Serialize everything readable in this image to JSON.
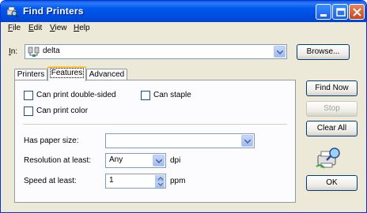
{
  "window": {
    "title": "Find Printers"
  },
  "menu": [
    {
      "label": "File",
      "key": "F",
      "rest": "ile"
    },
    {
      "label": "Edit",
      "key": "E",
      "rest": "dit"
    },
    {
      "label": "View",
      "key": "V",
      "rest": "iew"
    },
    {
      "label": "Help",
      "key": "H",
      "rest": "elp"
    }
  ],
  "location": {
    "label_key": "I",
    "label_rest": "n:",
    "value": "delta"
  },
  "tabs": [
    {
      "label": "Printers",
      "active": false
    },
    {
      "label": "Features",
      "active": true
    },
    {
      "label": "Advanced",
      "active": false
    }
  ],
  "features": {
    "double_sided": {
      "label": "Can print double-sided",
      "checked": false
    },
    "staple": {
      "label": "Can staple",
      "checked": false
    },
    "color": {
      "label": "Can print color",
      "checked": false
    },
    "paper_size": {
      "label": "Has paper size:",
      "value": ""
    },
    "resolution": {
      "label": "Resolution at least:",
      "value": "Any",
      "unit": "dpi"
    },
    "speed": {
      "label": "Speed at least:",
      "value": "1",
      "unit": "ppm"
    }
  },
  "buttons": {
    "browse": "Browse...",
    "find_now": "Find Now",
    "stop": "Stop",
    "clear_all": "Clear All",
    "ok": "OK"
  }
}
